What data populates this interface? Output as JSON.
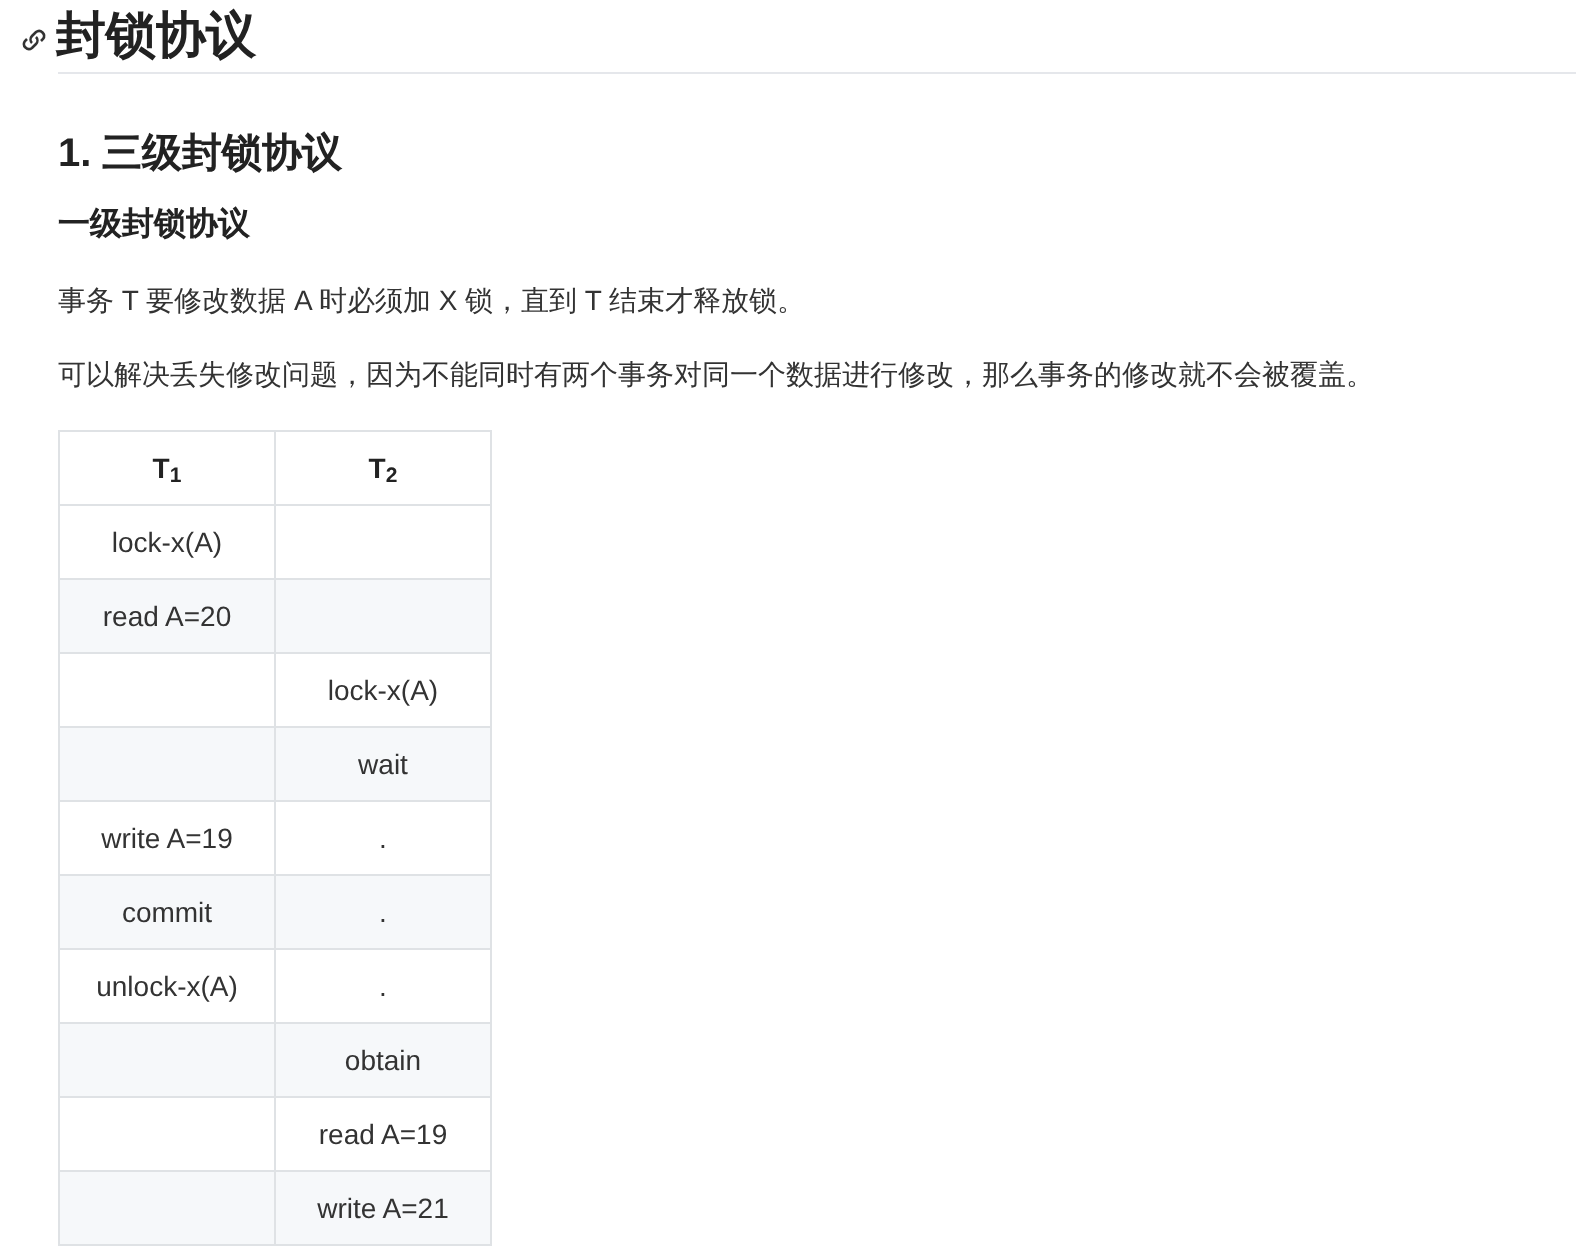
{
  "title": "封锁协议",
  "section": {
    "heading": "1. 三级封锁协议",
    "subheading": "一级封锁协议",
    "paragraphs": [
      "事务 T 要修改数据 A 时必须加 X 锁，直到 T 结束才释放锁。",
      "可以解决丢失修改问题，因为不能同时有两个事务对同一个数据进行修改，那么事务的修改就不会被覆盖。"
    ],
    "table": {
      "columns": [
        "T$_{1}$",
        "T$_{2}$"
      ],
      "rows": [
        [
          "lock-x(A)",
          ""
        ],
        [
          "read A=20",
          ""
        ],
        [
          "",
          "lock-x(A)"
        ],
        [
          "",
          "wait"
        ],
        [
          "write A=19",
          "."
        ],
        [
          "commit",
          "."
        ],
        [
          "unlock-x(A)",
          "."
        ],
        [
          "",
          "obtain"
        ],
        [
          "",
          "read A=19"
        ],
        [
          "",
          "write A=21"
        ]
      ]
    }
  }
}
